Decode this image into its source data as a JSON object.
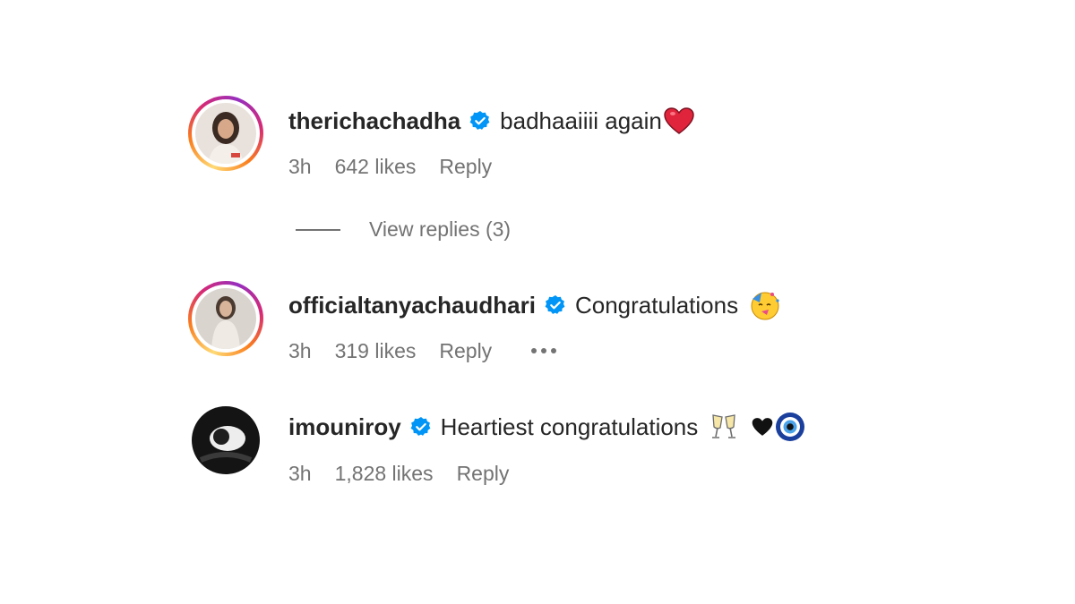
{
  "comments": [
    {
      "username": "therichachadha",
      "verified": true,
      "text": "badhaaiiii again",
      "emoji": "red-heart-emoji",
      "time": "3h",
      "likes": "642 likes",
      "reply": "Reply",
      "story_ring": true
    },
    {
      "username": "officialtanyachaudhari",
      "verified": true,
      "text": "Congratulations",
      "emoji": "partying-face-emoji",
      "time": "3h",
      "likes": "319 likes",
      "reply": "Reply",
      "story_ring": true
    },
    {
      "username": "imouniroy",
      "verified": true,
      "text": "Heartiest congratulations",
      "emoji": "clinking-glasses-black-heart-nazar-emoji",
      "time": "3h",
      "likes": "1,828 likes",
      "reply": "Reply",
      "story_ring": false
    }
  ],
  "view_replies": "View replies (3)",
  "colors": {
    "text_primary": "#262626",
    "text_secondary": "#737373",
    "verified_blue": "#0095f6",
    "heart_red": "#e0245e"
  }
}
